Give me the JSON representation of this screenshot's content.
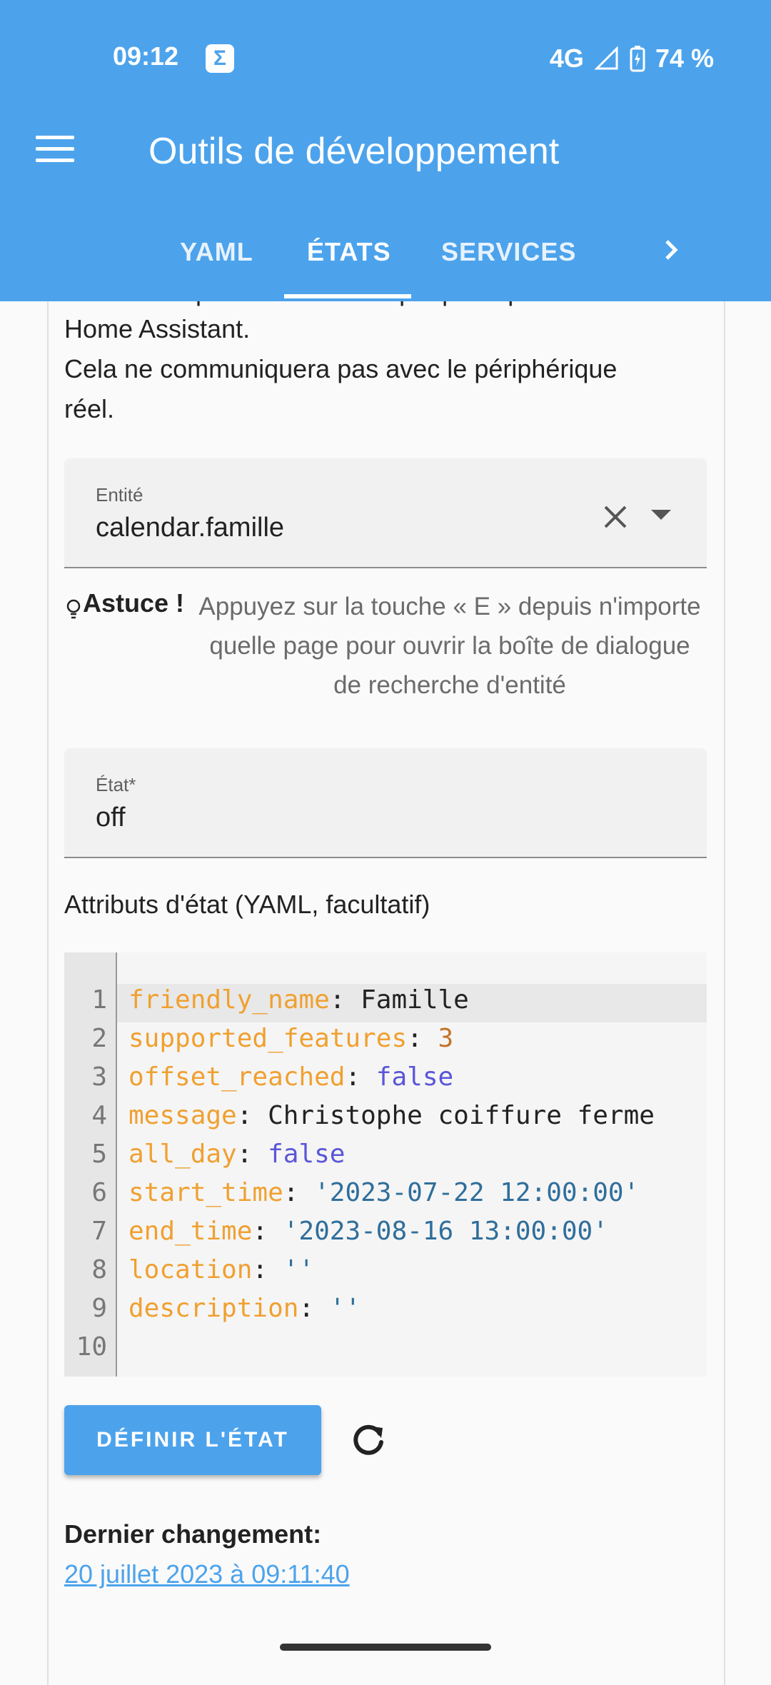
{
  "status_bar": {
    "time": "09:12",
    "badge": "Σ",
    "network": "4G",
    "battery": "74 %"
  },
  "header": {
    "title": "Outils de développement",
    "tabs": [
      {
        "label": "YAML"
      },
      {
        "label": "ÉTATS"
      },
      {
        "label": "SERVICES"
      }
    ]
  },
  "description": {
    "partial_line": "Définir la représentation d'un périphérique dans",
    "line1": "Home Assistant.",
    "line2": "Cela ne communiquera pas avec le périphérique",
    "line3": "réel."
  },
  "entity_field": {
    "label": "Entité",
    "value": "calendar.famille"
  },
  "tip": {
    "label": "Astuce !",
    "text": "Appuyez sur la touche « E » depuis n'importe quelle page pour ouvrir la boîte de dialogue de recherche d'entité"
  },
  "state_field": {
    "label": "État*",
    "value": "off"
  },
  "attributes": {
    "title": "Attributs d'état (YAML, facultatif)",
    "lines": [
      {
        "num": "1",
        "key": "friendly_name",
        "value": "Famille"
      },
      {
        "num": "2",
        "key": "supported_features",
        "value": "3"
      },
      {
        "num": "3",
        "key": "offset_reached",
        "value": "false"
      },
      {
        "num": "4",
        "key": "message",
        "value": "Christophe coiffure ferme"
      },
      {
        "num": "5",
        "key": "all_day",
        "value": "false"
      },
      {
        "num": "6",
        "key": "start_time",
        "value": "'2023-07-22 12:00:00'"
      },
      {
        "num": "7",
        "key": "end_time",
        "value": "'2023-08-16 13:00:00'"
      },
      {
        "num": "8",
        "key": "location",
        "value": "''"
      },
      {
        "num": "9",
        "key": "description",
        "value": "''"
      },
      {
        "num": "10",
        "key": "",
        "value": ""
      }
    ]
  },
  "actions": {
    "set_state_label": "DÉFINIR L'ÉTAT"
  },
  "last_change": {
    "label": "Dernier changement:",
    "date": "20 juillet 2023 à 09:11:40"
  },
  "colors": {
    "primary": "#4ca3ec",
    "yaml_key": "#f0a030",
    "yaml_bool": "#5a56d8",
    "yaml_string": "#2f6e9b"
  }
}
